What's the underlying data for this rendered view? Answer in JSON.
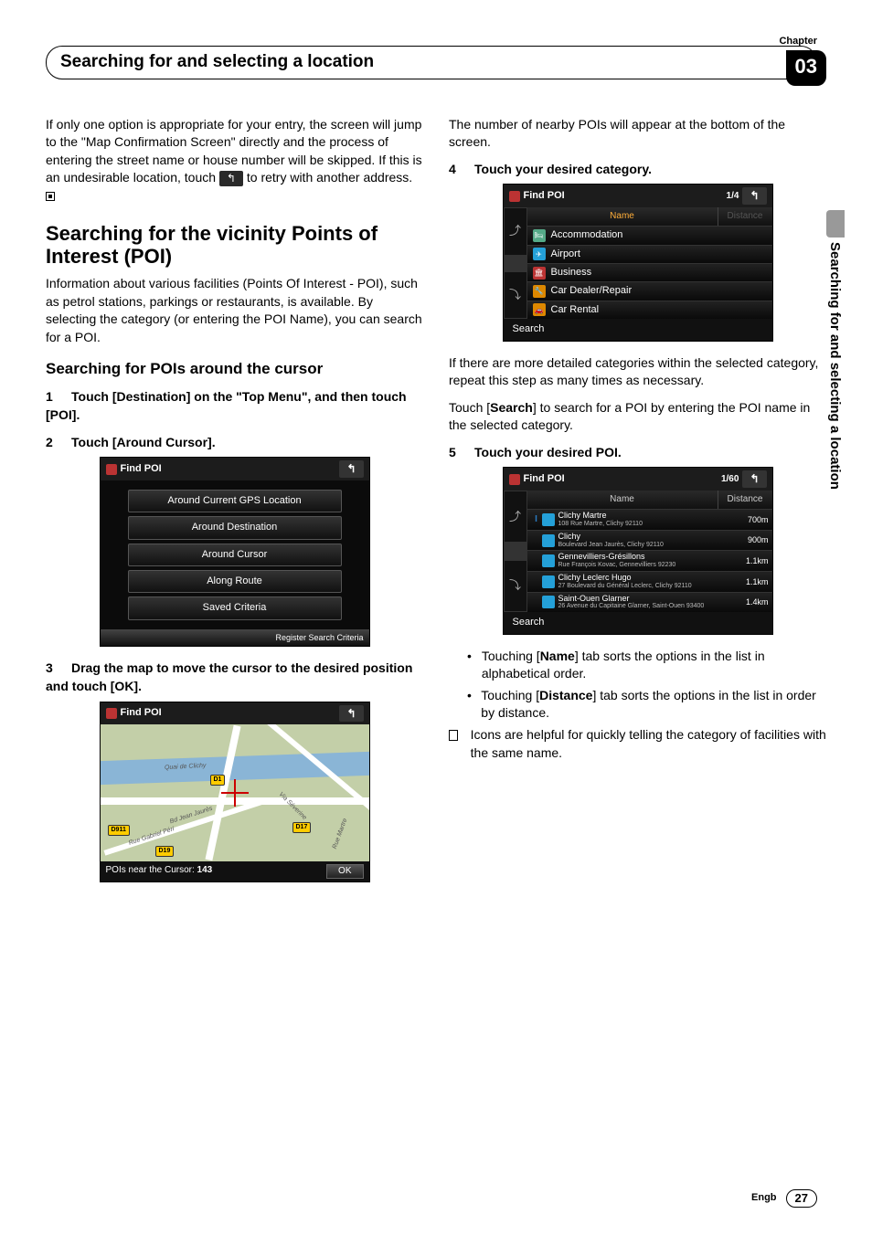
{
  "chapter": {
    "label": "Chapter",
    "number": "03",
    "title": "Searching for and selecting a location"
  },
  "sideTab": "Searching for and selecting a location",
  "footer": {
    "lang": "Engb",
    "page": "27"
  },
  "col1": {
    "intro": "If only one option is appropriate for your entry, the screen will jump to the \"Map Confirmation Screen\" directly and the process of entering the street name or house number will be skipped. If this is an undesirable location, touch ",
    "intro_tail": " to retry with another address.",
    "h2": "Searching for the vicinity Points of Interest (POI)",
    "p2": "Information about various facilities (Points Of Interest - POI), such as petrol stations, parkings or restaurants, is available. By selecting the category (or entering the POI Name), you can search for a POI.",
    "h3": "Searching for POIs around the cursor",
    "step1": "Touch [Destination] on the \"Top Menu\", and then touch [POI].",
    "step2": "Touch [Around Cursor].",
    "step3": "Drag the map to move the cursor to the desired position and touch [OK].",
    "menu_screen": {
      "title": "Find POI",
      "items": [
        "Around Current GPS Location",
        "Around Destination",
        "Around Cursor",
        "Along Route",
        "Saved Criteria"
      ],
      "footer": "Register Search Criteria"
    },
    "map_screen": {
      "title": "Find POI",
      "roads": [
        "D1",
        "D911",
        "D17",
        "D19"
      ],
      "streets": [
        "Quai de Clichy",
        "Rue Gabriel Péri",
        "Bd Jean Jaurès",
        "Rue Martre",
        "Via Séverine"
      ],
      "footer_label": "POIs near the Cursor:",
      "footer_count": "143",
      "ok": "OK"
    }
  },
  "col2": {
    "p1": "The number of nearby POIs will appear at the bottom of the screen.",
    "step4": "Touch your desired category.",
    "cat_screen": {
      "title": "Find POI",
      "count": "1/4",
      "tabs": {
        "name": "Name",
        "distance": "Distance"
      },
      "items": [
        "Accommodation",
        "Airport",
        "Business",
        "Car Dealer/Repair",
        "Car Rental"
      ],
      "search": "Search"
    },
    "p2a": "If there are more detailed categories within the selected category, repeat this step as many times as necessary.",
    "p2b_pre": "Touch [",
    "p2b_bold": "Search",
    "p2b_post": "] to search for a POI by entering the POI name in the selected category.",
    "step5": "Touch your desired POI.",
    "res_screen": {
      "title": "Find POI",
      "count": "1/60",
      "tabs": {
        "name": "Name",
        "distance": "Distance"
      },
      "rows": [
        {
          "name": "Clichy Martre",
          "addr": "108 Rue Martre, Clichy 92110",
          "dist": "700m"
        },
        {
          "name": "Clichy",
          "addr": "Boulevard Jean Jaurès, Clichy 92110",
          "dist": "900m"
        },
        {
          "name": "Gennevilliers-Grésillons",
          "addr": "Rue François Kovac, Gennevilliers 92230",
          "dist": "1.1km"
        },
        {
          "name": "Clichy Leclerc Hugo",
          "addr": "27 Boulevard du Général Leclerc, Clichy 92110",
          "dist": "1.1km"
        },
        {
          "name": "Saint-Ouen Glarner",
          "addr": "26 Avenue du Capitaine Glarner, Saint-Ouen 93400",
          "dist": "1.4km"
        }
      ],
      "search": "Search"
    },
    "bullets": [
      {
        "pre": "Touching [",
        "bold": "Name",
        "post": "] tab sorts the options in the list in alphabetical order."
      },
      {
        "pre": "Touching [",
        "bold": "Distance",
        "post": "] tab sorts the options in the list in order by distance."
      }
    ],
    "note": "Icons are helpful for quickly telling the category of facilities with the same name."
  }
}
